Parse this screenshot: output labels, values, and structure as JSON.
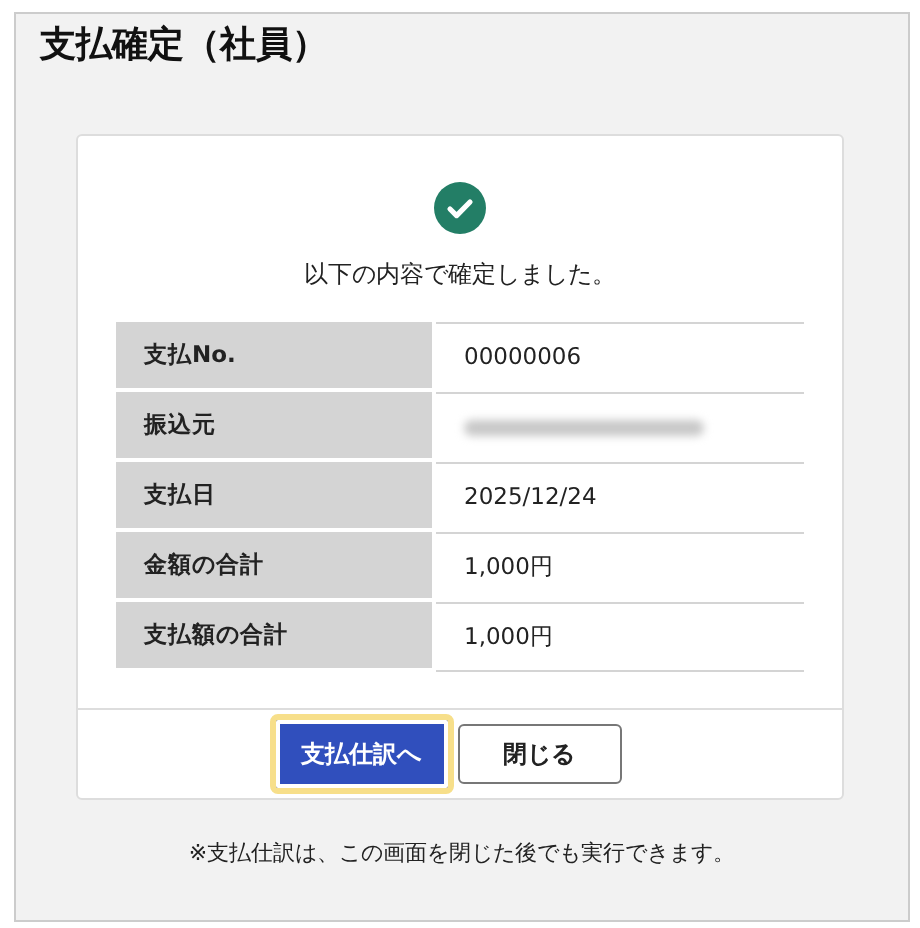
{
  "title": "支払確定（社員）",
  "message": "以下の内容で確定しました。",
  "details": [
    {
      "label": "支払No.",
      "kind": "text",
      "value": "00000006"
    },
    {
      "label": "振込元",
      "kind": "redacted"
    },
    {
      "label": "支払日",
      "kind": "text",
      "value": "2025/12/24"
    },
    {
      "label": "金額の合計",
      "kind": "text",
      "value": "1,000円"
    },
    {
      "label": "支払額の合計",
      "kind": "text",
      "value": "1,000円"
    }
  ],
  "buttons": [
    {
      "label": "支払仕訳へ",
      "kind": "primary",
      "focused": true
    },
    {
      "label": "閉じる",
      "kind": "secondary",
      "focused": false
    }
  ],
  "note": "※支払仕訳は、この画面を閉じた後でも実行できます。"
}
